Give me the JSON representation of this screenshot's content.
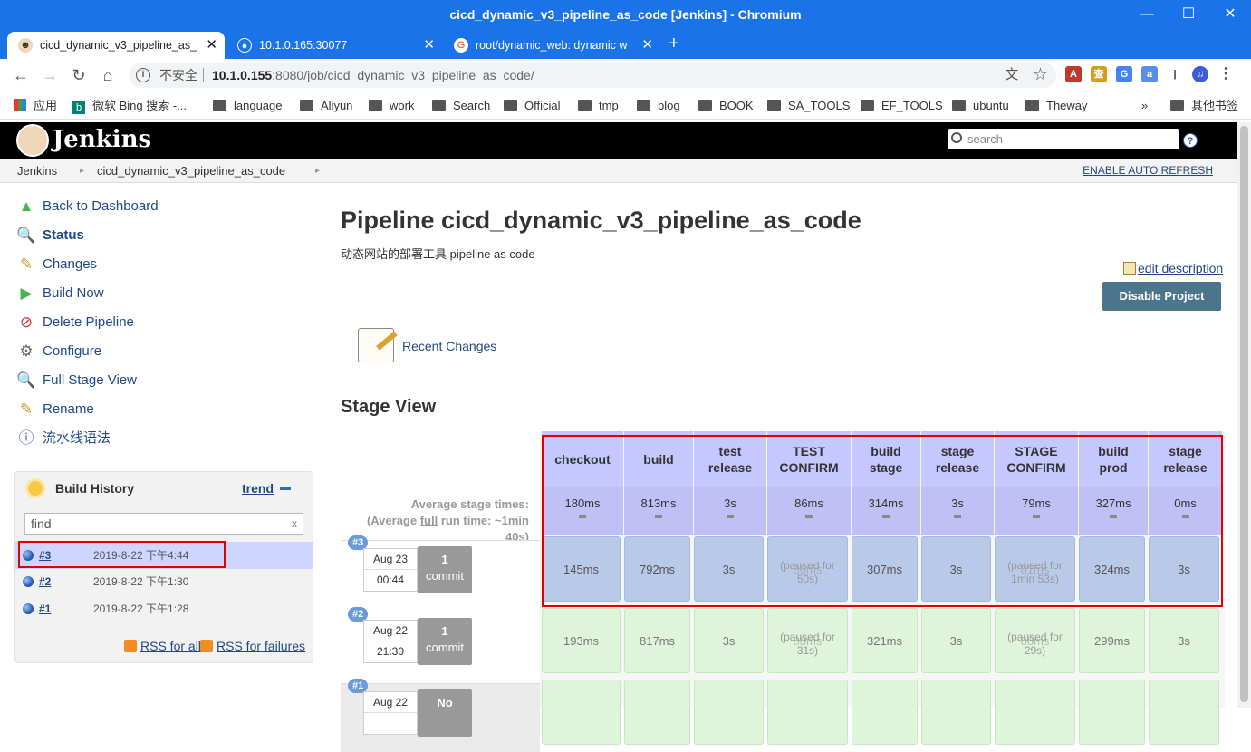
{
  "window": {
    "title": "cicd_dynamic_v3_pipeline_as_code [Jenkins] - Chromium"
  },
  "tabs": [
    {
      "label": "cicd_dynamic_v3_pipeline_as_",
      "active": true
    },
    {
      "label": "10.1.0.165:30077",
      "active": false
    },
    {
      "label": "root/dynamic_web: dynamic w",
      "active": false
    }
  ],
  "toolbar": {
    "insecure": "不安全",
    "url_host": "10.1.0.155",
    "url_rest": ":8080/job/cicd_dynamic_v3_pipeline_as_code/"
  },
  "bookmarks": {
    "apps": "应用",
    "bing": "微软 Bing 搜索 -...",
    "folders": [
      "language",
      "Aliyun",
      "work",
      "Search",
      "Official",
      "tmp",
      "blog",
      "BOOK",
      "SA_TOOLS",
      "EF_TOOLS",
      "ubuntu",
      "Theway"
    ],
    "more": "»",
    "other": "其他书签"
  },
  "jenkins": {
    "title": "Jenkins",
    "search_placeholder": "search"
  },
  "breadcrumb": {
    "root": "Jenkins",
    "job": "cicd_dynamic_v3_pipeline_as_code",
    "auto_refresh": "ENABLE AUTO REFRESH"
  },
  "sidebar": {
    "items": [
      {
        "label": "Back to Dashboard",
        "icon": "up-arrow-icon"
      },
      {
        "label": "Status",
        "icon": "magnifier-icon"
      },
      {
        "label": "Changes",
        "icon": "notepad-icon"
      },
      {
        "label": "Build Now",
        "icon": "clock-play-icon"
      },
      {
        "label": "Delete Pipeline",
        "icon": "no-entry-icon"
      },
      {
        "label": "Configure",
        "icon": "gear-icon"
      },
      {
        "label": "Full Stage View",
        "icon": "magnifier-icon"
      },
      {
        "label": "Rename",
        "icon": "notepad-icon"
      },
      {
        "label": "流水线语法",
        "icon": "help-icon"
      }
    ]
  },
  "build_history": {
    "title": "Build History",
    "trend": "trend",
    "find": "find",
    "builds": [
      {
        "num": "#3",
        "date": "2019-8-22 下午4:44"
      },
      {
        "num": "#2",
        "date": "2019-8-22 下午1:30"
      },
      {
        "num": "#1",
        "date": "2019-8-22 下午1:28"
      }
    ],
    "rss_all": "RSS for all",
    "rss_failures": "RSS for failures"
  },
  "main": {
    "title": "Pipeline cicd_dynamic_v3_pipeline_as_code",
    "description": "动态网站的部署工具 pipeline as code",
    "edit_description": "edit description",
    "disable_project": "Disable Project",
    "recent_changes": "Recent Changes",
    "stage_view": "Stage View",
    "avg_label_1": "Average stage times:",
    "avg_label_2a": "(Average ",
    "avg_label_2b": "full",
    "avg_label_2c": " run time: ~1min",
    "avg_label_3": "40s)"
  },
  "stages": {
    "headers": [
      "checkout",
      "build",
      "test release",
      "TEST CONFIRM",
      "build stage",
      "stage release",
      "STAGE CONFIRM",
      "build prod",
      "stage release"
    ],
    "averages": [
      "180ms",
      "813ms",
      "3s",
      "86ms",
      "314ms",
      "3s",
      "79ms",
      "327ms",
      "0ms"
    ],
    "runs": [
      {
        "num": "#3",
        "date": "Aug 23",
        "time": "00:44",
        "commits": "1",
        "commit_label": "commit",
        "cells": [
          "145ms",
          "792ms",
          "3s",
          "86ms",
          "307ms",
          "3s",
          "81ms",
          "324ms",
          "3s"
        ],
        "paused": {
          "3": "(paused for 50s)",
          "6": "(paused for 1min 53s)"
        }
      },
      {
        "num": "#2",
        "date": "Aug 22",
        "time": "21:30",
        "commits": "1",
        "commit_label": "commit",
        "cells": [
          "193ms",
          "817ms",
          "3s",
          "88ms",
          "321ms",
          "3s",
          "88ms",
          "299ms",
          "3s"
        ],
        "paused": {
          "3": "(paused for 31s)",
          "6": "(paused for 29s)"
        }
      },
      {
        "num": "#1",
        "date": "Aug 22",
        "time": "",
        "commits": "No",
        "commit_label": "",
        "cells": [
          "",
          "",
          "",
          "",
          "",
          "",
          "",
          "",
          ""
        ],
        "paused": {}
      }
    ]
  }
}
